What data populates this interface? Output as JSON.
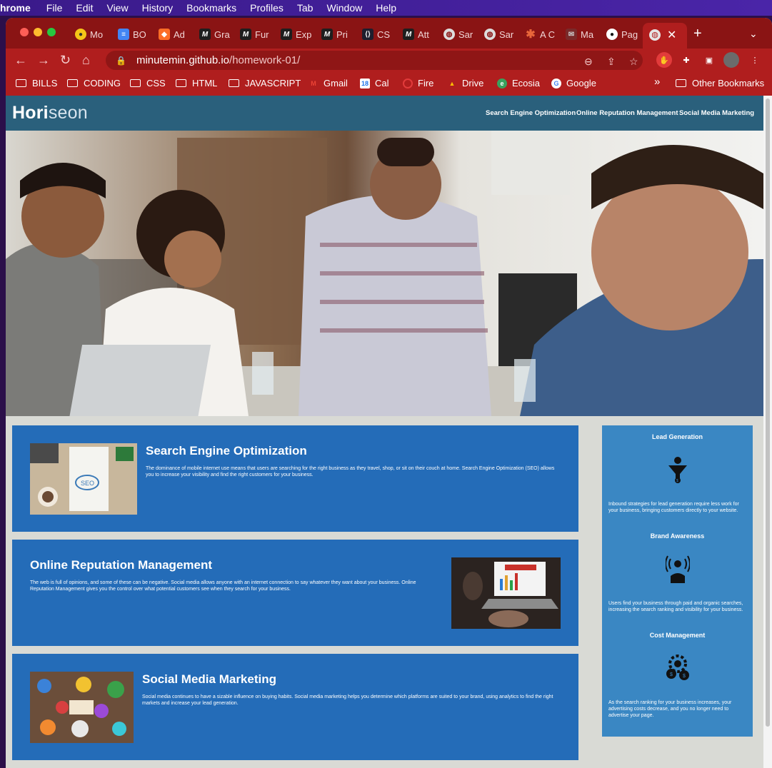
{
  "menubar": {
    "app": "hrome",
    "items": [
      "File",
      "Edit",
      "View",
      "History",
      "Bookmarks",
      "Profiles",
      "Tab",
      "Window",
      "Help"
    ]
  },
  "tabs": [
    {
      "label": "Mo",
      "icon": "lime-icon",
      "color": "#f5c518"
    },
    {
      "label": "BO",
      "icon": "docs-icon",
      "color": "#4285f4"
    },
    {
      "label": "Ad",
      "icon": "gitlab-icon",
      "color": "#fc6d26"
    },
    {
      "label": "Gra",
      "icon": "m-icon",
      "color": "#1e1e1e"
    },
    {
      "label": "Fur",
      "icon": "m-icon",
      "color": "#1e1e1e"
    },
    {
      "label": "Exp",
      "icon": "m-icon",
      "color": "#1e1e1e"
    },
    {
      "label": "Pri",
      "icon": "m-icon",
      "color": "#1e1e1e"
    },
    {
      "label": "CS",
      "icon": "code-icon",
      "color": "#1e1e2e"
    },
    {
      "label": "Att",
      "icon": "m-icon",
      "color": "#1e1e1e"
    },
    {
      "label": "Sar",
      "icon": "globe-icon",
      "color": "#dddddd"
    },
    {
      "label": "Sar",
      "icon": "globe-icon",
      "color": "#dddddd"
    },
    {
      "label": "A C",
      "icon": "asterisk-icon",
      "color": "#e8663a"
    },
    {
      "label": "Ma",
      "icon": "mail-icon",
      "color": "#7a2a2a"
    },
    {
      "label": "Pag",
      "icon": "github-icon",
      "color": "#ffffff"
    }
  ],
  "active_tab": {
    "close": "✕"
  },
  "address": {
    "host": "minutemin.github.io",
    "path": "/homework-01/"
  },
  "bookmarks": [
    {
      "label": "BILLS",
      "type": "folder"
    },
    {
      "label": "CODING",
      "type": "folder"
    },
    {
      "label": "CSS",
      "type": "folder"
    },
    {
      "label": "HTML",
      "type": "folder"
    },
    {
      "label": "JAVASCRIPT",
      "type": "folder"
    },
    {
      "label": "Gmail",
      "type": "site",
      "icon": "gmail-icon"
    },
    {
      "label": "Cal",
      "type": "site",
      "icon": "calendar-icon"
    },
    {
      "label": "Fire",
      "type": "site",
      "icon": "fire-icon"
    },
    {
      "label": "Drive",
      "type": "site",
      "icon": "drive-icon"
    },
    {
      "label": "Ecosia",
      "type": "site",
      "icon": "ecosia-icon"
    },
    {
      "label": "Google",
      "type": "site",
      "icon": "google-icon"
    }
  ],
  "bookmarks_more": "»",
  "other_bookmarks": "Other Bookmarks",
  "site": {
    "logo_bold": "Hori",
    "logo_light": "seon",
    "nav": [
      "Search Engine Optimization",
      "Online Reputation Management",
      "Social Media Marketing"
    ],
    "sections": [
      {
        "title": "Search Engine Optimization",
        "text": "The dominance of mobile internet use means that users are searching for the right business as they travel, shop, or sit on their couch at home. Search Engine Optimization (SEO) allows you to increase your visibility and find the right customers for your business."
      },
      {
        "title": "Online Reputation Management",
        "text": "The web is full of opinions, and some of these can be negative. Social media allows anyone with an internet connection to say whatever they want about your business. Online Reputation Management gives you the control over what potential customers see when they search for your business."
      },
      {
        "title": "Social Media Marketing",
        "text": "Social media continues to have a sizable influence on buying habits. Social media marketing helps you determine which platforms are suited to your brand, using analytics to find the right markets and increase your lead generation."
      }
    ],
    "benefits": [
      {
        "title": "Lead Generation",
        "icon": "funnel-icon",
        "text": "Inbound strategies for lead generation require less work for your business, bringing customers directly to your website."
      },
      {
        "title": "Brand Awareness",
        "icon": "broadcast-person-icon",
        "text": "Users find your business through paid and organic searches, increasing the search ranking and visibility for your business."
      },
      {
        "title": "Cost Management",
        "icon": "gear-money-icon",
        "text": "As the search ranking for your business increases, your advertising costs decrease, and you no longer need to advertise your page."
      }
    ],
    "colors": {
      "header": "#2a607c",
      "card": "#246cb8",
      "benefits": "#3a87c3",
      "page": "#d9dad5"
    }
  }
}
